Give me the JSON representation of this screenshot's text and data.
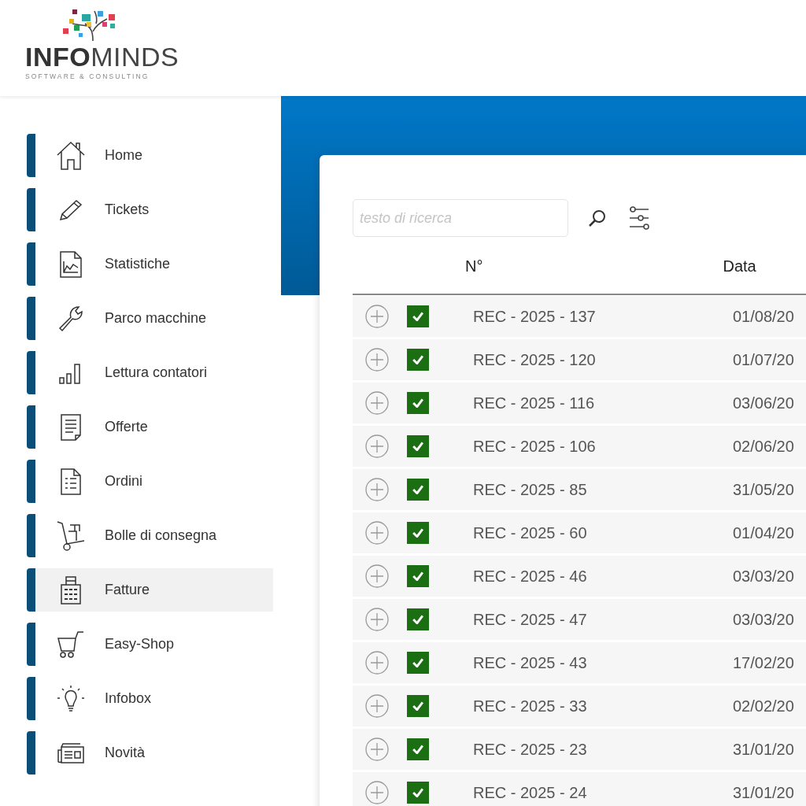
{
  "logo": {
    "name": "**INFO**MINDS",
    "tagline": "SOFTWARE & CONSULTING"
  },
  "sidebar": {
    "items": [
      {
        "label": "Home",
        "selected": false
      },
      {
        "label": "Tickets",
        "selected": false
      },
      {
        "label": "Statistiche",
        "selected": false
      },
      {
        "label": "Parco macchine",
        "selected": false
      },
      {
        "label": "Lettura contatori",
        "selected": false
      },
      {
        "label": "Offerte",
        "selected": false
      },
      {
        "label": "Ordini",
        "selected": false
      },
      {
        "label": "Bolle di consegna",
        "selected": false
      },
      {
        "label": "Fatture",
        "selected": true
      },
      {
        "label": "Easy-Shop",
        "selected": false
      },
      {
        "label": "Infobox",
        "selected": false
      },
      {
        "label": "Novità",
        "selected": false
      }
    ]
  },
  "search": {
    "placeholder": "testo di ricerca"
  },
  "table": {
    "columns": [
      "N°",
      "Data"
    ],
    "rows": [
      {
        "number": "REC - 2025 - 137",
        "date": "01/08/20",
        "checked": true
      },
      {
        "number": "REC - 2025 - 120",
        "date": "01/07/20",
        "checked": true
      },
      {
        "number": "REC - 2025 - 116",
        "date": "03/06/20",
        "checked": true
      },
      {
        "number": "REC - 2025 - 106",
        "date": "02/06/20",
        "checked": true
      },
      {
        "number": "REC - 2025 - 85",
        "date": "31/05/20",
        "checked": true
      },
      {
        "number": "REC - 2025 - 60",
        "date": "01/04/20",
        "checked": true
      },
      {
        "number": "REC - 2025 - 46",
        "date": "03/03/20",
        "checked": true
      },
      {
        "number": "REC - 2025 - 47",
        "date": "03/03/20",
        "checked": true
      },
      {
        "number": "REC - 2025 - 43",
        "date": "17/02/20",
        "checked": true
      },
      {
        "number": "REC - 2025 - 33",
        "date": "02/02/20",
        "checked": true
      },
      {
        "number": "REC - 2025 - 23",
        "date": "31/01/20",
        "checked": true
      },
      {
        "number": "REC - 2025 - 24",
        "date": "31/01/20",
        "checked": true
      }
    ]
  }
}
